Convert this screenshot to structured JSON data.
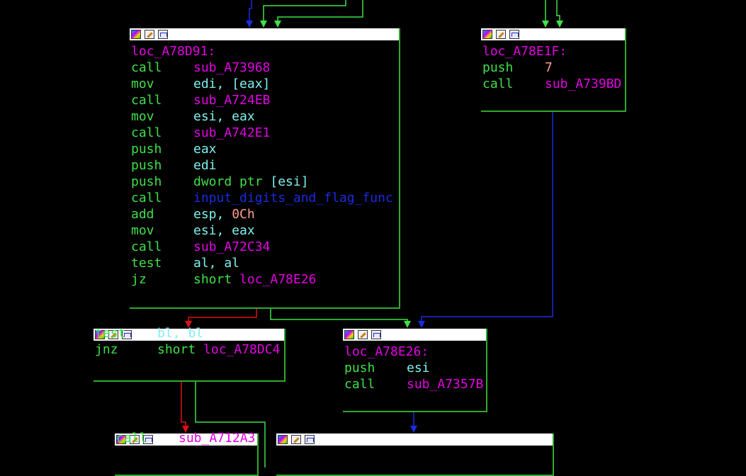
{
  "nodes": {
    "main": {
      "label": "loc_A78D91:",
      "lines": [
        {
          "m": "call",
          "ops": [
            {
              "t": "sub_A73968",
              "c": "sub"
            }
          ]
        },
        {
          "m": "mov",
          "ops": [
            {
              "t": "edi",
              "c": "reg"
            },
            {
              "t": ", ",
              "c": "reg"
            },
            {
              "t": "[eax]",
              "c": "reg"
            }
          ]
        },
        {
          "m": "call",
          "ops": [
            {
              "t": "sub_A724EB",
              "c": "sub"
            }
          ]
        },
        {
          "m": "mov",
          "ops": [
            {
              "t": "esi, eax",
              "c": "reg"
            }
          ]
        },
        {
          "m": "call",
          "ops": [
            {
              "t": "sub_A742E1",
              "c": "sub"
            }
          ]
        },
        {
          "m": "push",
          "ops": [
            {
              "t": "eax",
              "c": "reg"
            }
          ]
        },
        {
          "m": "push",
          "ops": [
            {
              "t": "edi",
              "c": "reg"
            }
          ]
        },
        {
          "m": "push",
          "ops": [
            {
              "t": "dword ptr ",
              "c": "grn"
            },
            {
              "t": "[esi]",
              "c": "reg"
            }
          ]
        },
        {
          "m": "call",
          "ops": [
            {
              "t": "input_digits_and_flag_func",
              "c": "imp"
            }
          ]
        },
        {
          "m": "add",
          "ops": [
            {
              "t": "esp, ",
              "c": "reg"
            },
            {
              "t": "0Ch",
              "c": "num"
            }
          ]
        },
        {
          "m": "mov",
          "ops": [
            {
              "t": "esi, eax",
              "c": "reg"
            }
          ]
        },
        {
          "m": "call",
          "ops": [
            {
              "t": "sub_A72C34",
              "c": "sub"
            }
          ]
        },
        {
          "m": "test",
          "ops": [
            {
              "t": "al, al",
              "c": "reg"
            }
          ]
        },
        {
          "m": "jz",
          "ops": [
            {
              "t": "short ",
              "c": "grn"
            },
            {
              "t": "loc_A78E26",
              "c": "sub"
            }
          ]
        }
      ]
    },
    "right_top": {
      "label": "loc_A78E1F:",
      "lines": [
        {
          "m": "push",
          "ops": [
            {
              "t": "7",
              "c": "num"
            }
          ]
        },
        {
          "m": "call",
          "ops": [
            {
              "t": "sub_A739BD",
              "c": "sub"
            }
          ]
        }
      ]
    },
    "test_node": {
      "lines": [
        {
          "m": "test",
          "ops": [
            {
              "t": "bl, bl",
              "c": "reg"
            }
          ]
        },
        {
          "m": "jnz",
          "ops": [
            {
              "t": "short ",
              "c": "grn"
            },
            {
              "t": "loc_A78DC4",
              "c": "sub"
            }
          ]
        }
      ]
    },
    "e26": {
      "label": "loc_A78E26:",
      "lines": [
        {
          "m": "push",
          "ops": [
            {
              "t": "esi",
              "c": "reg"
            }
          ]
        },
        {
          "m": "call",
          "ops": [
            {
              "t": "sub_A7357B",
              "c": "sub"
            }
          ]
        }
      ]
    },
    "bottom_left": {
      "lines": [
        {
          "m": "call",
          "ops": [
            {
              "t": "sub_A712A3",
              "c": "sub"
            }
          ]
        }
      ]
    }
  },
  "colors": {
    "true_edge": "#3fe04a",
    "false_edge": "#e01010",
    "uncond_edge": "#1a2ce0",
    "node_border": "#2eaa2e"
  }
}
